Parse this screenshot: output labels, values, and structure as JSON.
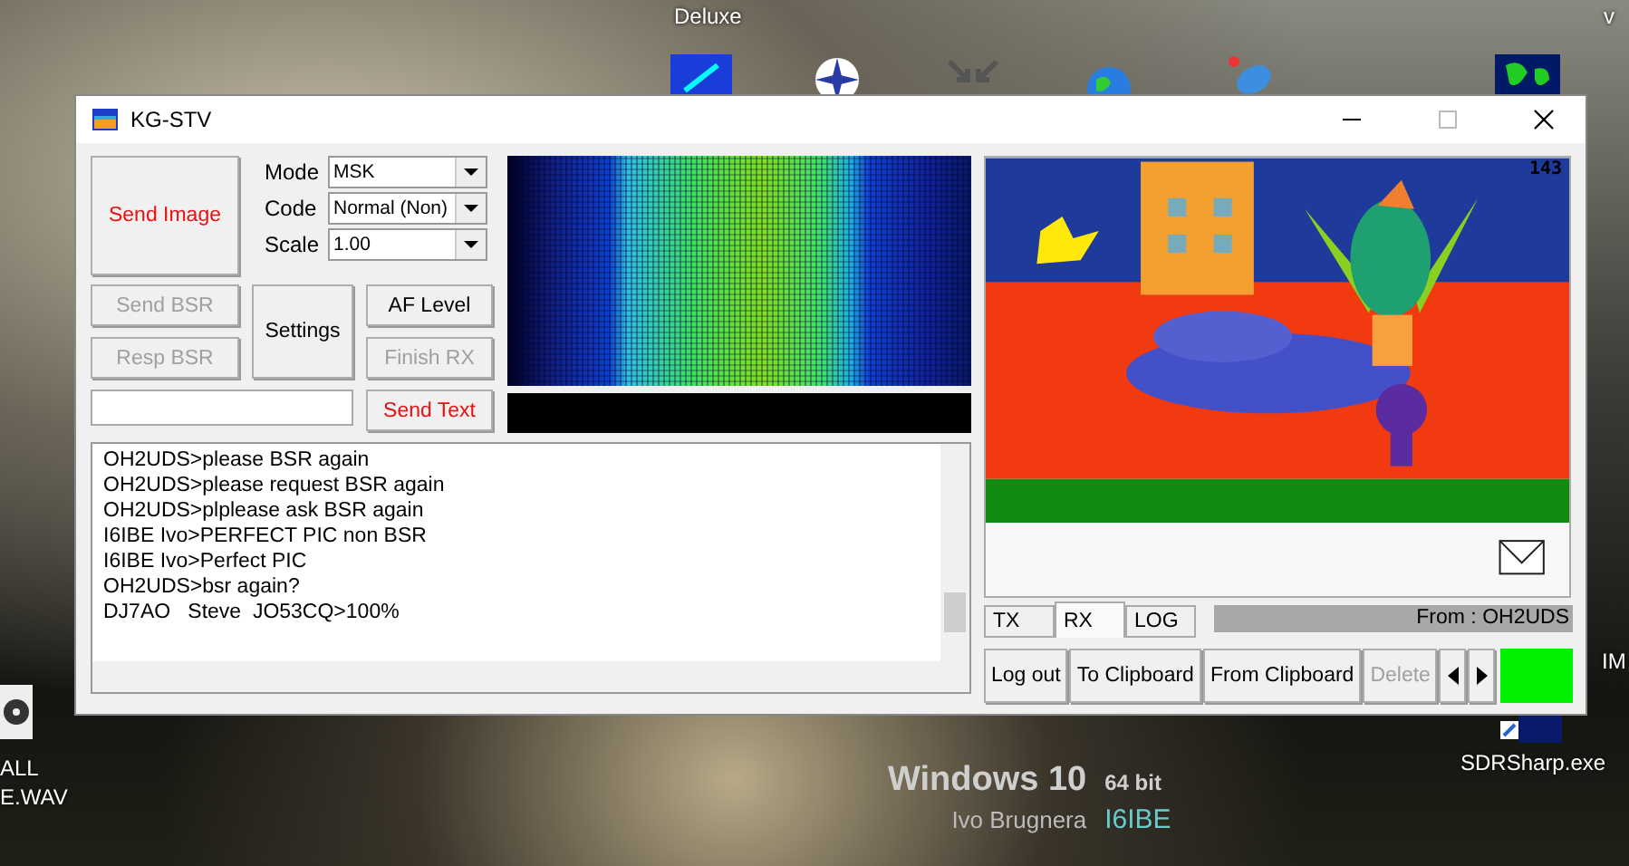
{
  "desktop": {
    "labels": [
      {
        "text": "Deluxe",
        "kind": "top"
      },
      {
        "text": "v",
        "kind": "corner"
      },
      {
        "text": "IM",
        "kind": "edge"
      },
      {
        "text": "ALL\nE.WAV",
        "kind": "file"
      },
      {
        "text": "SDRSharp.exe",
        "kind": "shortcut"
      }
    ],
    "banner": {
      "title": "Windows 10",
      "edition": "64 bit",
      "owner": "Ivo Brugnera",
      "callsign": "I6IBE"
    }
  },
  "window": {
    "title": "KG-STV"
  },
  "send_image": {
    "label": "Send Image"
  },
  "settings": [
    {
      "label": "Mode",
      "value": "MSK"
    },
    {
      "label": "Code",
      "value": "Normal (Non)"
    },
    {
      "label": "Scale",
      "value": "1.00"
    }
  ],
  "buttons": [
    {
      "label": "Send BSR",
      "disabled": true,
      "emphasis": false
    },
    {
      "label": "Settings",
      "disabled": false,
      "emphasis": false
    },
    {
      "label": "AF Level",
      "disabled": false,
      "emphasis": false
    },
    {
      "label": "Resp BSR",
      "disabled": true,
      "emphasis": false
    },
    {
      "label": "Finish RX",
      "disabled": true,
      "emphasis": false
    },
    {
      "label": "Send Text",
      "disabled": false,
      "emphasis": true
    }
  ],
  "log": [
    "OH2UDS>please BSR again",
    "OH2UDS>please request BSR again",
    "OH2UDS>plplease ask BSR again",
    "I6IBE Ivo>PERFECT PIC non BSR",
    "I6IBE Ivo>Perfect PIC",
    "OH2UDS>bsr again?",
    "DJ7AO   Steve  JO53CQ>100%"
  ],
  "picture": {
    "counter": "143"
  },
  "tabs": [
    {
      "label": "TX",
      "selected": false
    },
    {
      "label": "RX",
      "selected": true
    },
    {
      "label": "LOG",
      "selected": false
    }
  ],
  "status": "From : OH2UDS",
  "actions": [
    {
      "label": "Log out",
      "disabled": false
    },
    {
      "label": "To Clipboard",
      "disabled": false
    },
    {
      "label": "From Clipboard",
      "disabled": false
    },
    {
      "label": "Delete",
      "disabled": true
    }
  ]
}
